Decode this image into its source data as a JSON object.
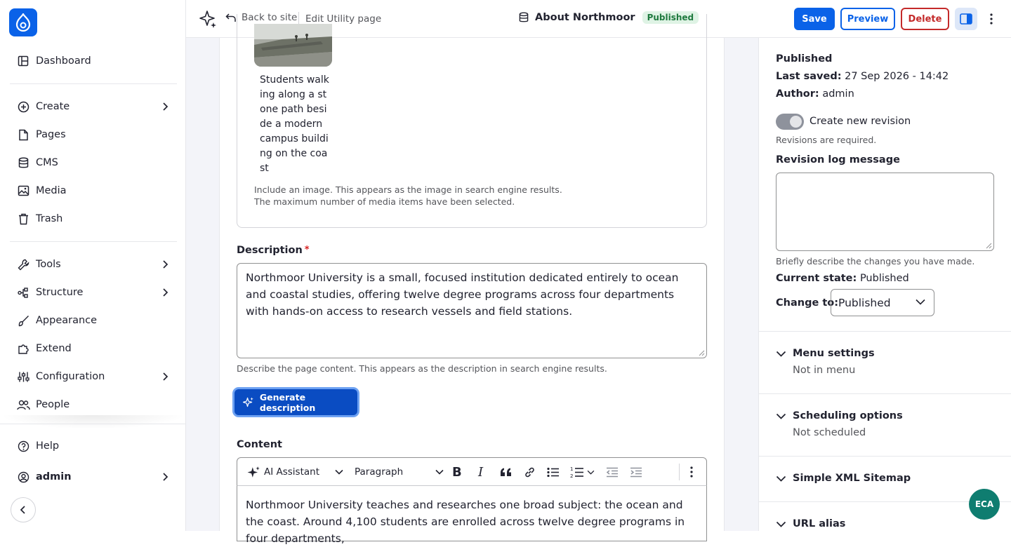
{
  "sidebar": {
    "items": [
      {
        "label": "Dashboard"
      },
      {
        "label": "Create"
      },
      {
        "label": "Pages"
      },
      {
        "label": "CMS"
      },
      {
        "label": "Media"
      },
      {
        "label": "Trash"
      },
      {
        "label": "Tools"
      },
      {
        "label": "Structure"
      },
      {
        "label": "Appearance"
      },
      {
        "label": "Extend"
      },
      {
        "label": "Configuration"
      },
      {
        "label": "People"
      },
      {
        "label": "Help"
      },
      {
        "label": "admin"
      }
    ]
  },
  "topbar": {
    "back_label": "Back to site",
    "edit_label": "Edit Utility page",
    "title": "About Northmoor",
    "status_badge": "Published",
    "save_label": "Save",
    "preview_label": "Preview",
    "delete_label": "Delete"
  },
  "media": {
    "caption": "Students walking along a stone path beside a modern campus building on the coast",
    "help_1": "Include an image. This appears as the image in search engine results.",
    "help_2": "The maximum number of media items have been selected."
  },
  "description": {
    "label": "Description",
    "required_mark": "*",
    "value": "Northmoor University is a small, focused institution dedicated entirely to ocean and coastal studies, offering twelve degree programs across four departments with hands-on access to research vessels and field stations.",
    "help": "Describe the page content. This appears as the description in search engine results.",
    "generate_label": "Generate description"
  },
  "content": {
    "label": "Content",
    "toolbar": {
      "ai_label": "AI Assistant",
      "paragraph_label": "Paragraph"
    },
    "body": "Northmoor University teaches and researches one broad subject: the ocean and the coast. Around 4,100 students are enrolled across twelve degree programs in four departments,"
  },
  "panel": {
    "status": "Published",
    "last_saved_label": "Last saved:",
    "last_saved_value": "27 Sep 2026 - 14:42",
    "author_label": "Author:",
    "author_value": "admin",
    "revision_toggle_label": "Create new revision",
    "revision_help": "Revisions are required.",
    "log_label": "Revision log message",
    "log_help": "Briefly describe the changes you have made.",
    "current_state_label": "Current state:",
    "current_state_value": "Published",
    "change_to_label": "Change to:",
    "change_to_value": "Published",
    "menu_settings": {
      "title": "Menu settings",
      "sub": "Not in menu"
    },
    "scheduling": {
      "title": "Scheduling options",
      "sub": "Not scheduled"
    },
    "sitemap": {
      "title": "Simple XML Sitemap"
    },
    "url_alias": {
      "title": "URL alias"
    }
  },
  "fab_label": "ECA",
  "colors": {
    "accent": "#0a62e8",
    "danger": "#c42a2a",
    "success_bg": "#dff3e5",
    "fab": "#0f7d70"
  }
}
